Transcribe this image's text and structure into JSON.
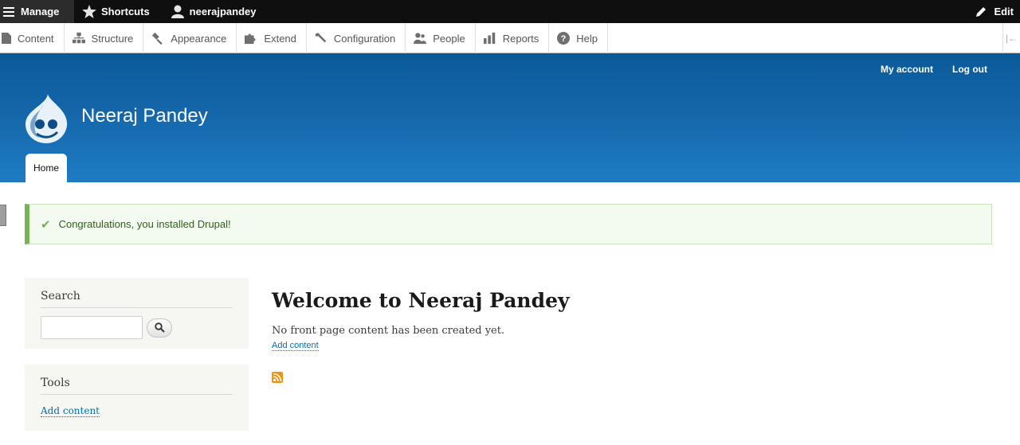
{
  "toolbar": {
    "manage_label": "Manage",
    "shortcuts_label": "Shortcuts",
    "user_label": "neerajpandey",
    "edit_label": "Edit"
  },
  "tray": {
    "items": [
      {
        "label": "Content",
        "icon": "file-icon"
      },
      {
        "label": "Structure",
        "icon": "sitemap-icon"
      },
      {
        "label": "Appearance",
        "icon": "paintbrush-icon"
      },
      {
        "label": "Extend",
        "icon": "puzzle-icon"
      },
      {
        "label": "Configuration",
        "icon": "wrench-icon"
      },
      {
        "label": "People",
        "icon": "people-icon"
      },
      {
        "label": "Reports",
        "icon": "bar-chart-icon"
      },
      {
        "label": "Help",
        "icon": "question-icon"
      }
    ]
  },
  "header": {
    "my_account": "My account",
    "log_out": "Log out",
    "site_name": "Neeraj Pandey",
    "home_tab": "Home"
  },
  "message": {
    "text": "Congratulations, you installed Drupal!"
  },
  "sidebar": {
    "search_title": "Search",
    "search_placeholder": "",
    "tools_title": "Tools",
    "tools_link": "Add content"
  },
  "main": {
    "title": "Welcome to Neeraj Pandey",
    "text": "No front page content has been created yet.",
    "add_content": "Add content"
  },
  "colors": {
    "header_top": "#0a5a9a",
    "header_bottom": "#1f7cc3",
    "link": "#0071b3",
    "status_green": "#77b259"
  }
}
